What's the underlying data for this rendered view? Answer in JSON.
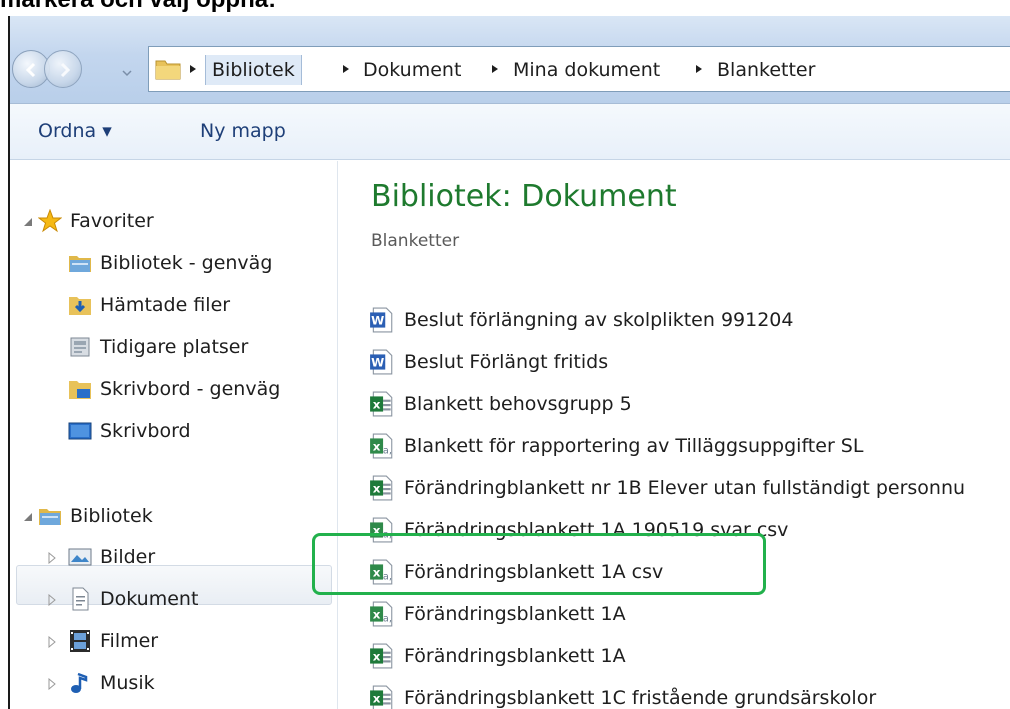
{
  "caption": "markera och välj öppna:",
  "breadcrumb": [
    {
      "label": "Bibliotek"
    },
    {
      "label": "Dokument"
    },
    {
      "label": "Mina dokument"
    },
    {
      "label": "Blanketter"
    }
  ],
  "toolbar": {
    "organize_label": "Ordna ▾",
    "new_folder_label": "Ny mapp"
  },
  "nav": {
    "favorites": {
      "label": "Favoriter",
      "items": [
        {
          "label": "Bibliotek - genväg",
          "icon": "library-icon"
        },
        {
          "label": "Hämtade filer",
          "icon": "downloads-folder-icon"
        },
        {
          "label": "Tidigare platser",
          "icon": "recent-places-icon"
        },
        {
          "label": "Skrivbord - genväg",
          "icon": "desktop-folder-icon"
        },
        {
          "label": "Skrivbord",
          "icon": "desktop-icon"
        }
      ]
    },
    "libraries": {
      "label": "Bibliotek",
      "items": [
        {
          "label": "Bilder",
          "icon": "pictures-icon"
        },
        {
          "label": "Dokument",
          "icon": "documents-icon",
          "selected": true
        },
        {
          "label": "Filmer",
          "icon": "videos-icon"
        },
        {
          "label": "Musik",
          "icon": "music-icon"
        }
      ]
    }
  },
  "content": {
    "title": "Bibliotek: Dokument",
    "subtitle": "Blanketter",
    "files": [
      {
        "name": "Beslut förlängning av skolplikten 991204",
        "type": "word"
      },
      {
        "name": "Beslut Förlängt fritids",
        "type": "word"
      },
      {
        "name": "Blankett behovsgrupp 5",
        "type": "excel"
      },
      {
        "name": "Blankett för rapportering av Tilläggsuppgifter SL",
        "type": "csv"
      },
      {
        "name": "Förändringblankett nr 1B Elever utan fullständigt personnu",
        "type": "excel"
      },
      {
        "name": "Förändringsblankett 1A 190519 svar csv",
        "type": "csv"
      },
      {
        "name": "Förändringsblankett 1A csv",
        "type": "csv",
        "highlighted": true
      },
      {
        "name": "Förändringsblankett 1A",
        "type": "csv"
      },
      {
        "name": "Förändringsblankett 1A",
        "type": "excel"
      },
      {
        "name": "Förändringsblankett 1C fristående grundsärskolor",
        "type": "excel"
      }
    ]
  },
  "colors": {
    "title_green": "#1e7a2e",
    "highlight_green": "#22b14c",
    "toolbar_text": "#1e3f78"
  }
}
